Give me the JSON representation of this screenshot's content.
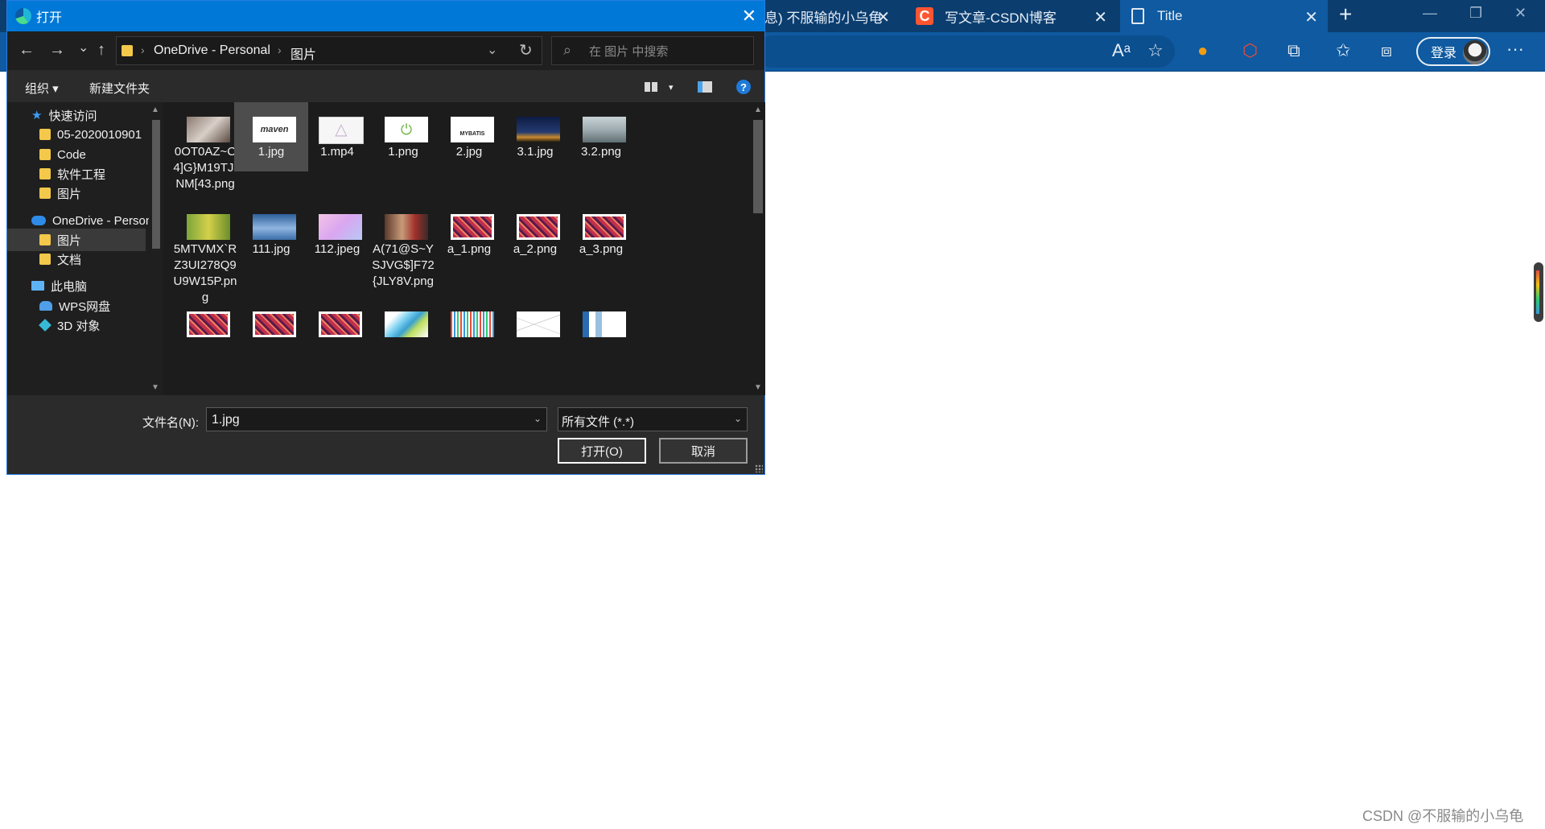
{
  "browser": {
    "tabs": [
      {
        "label": "息) 不服输的小乌龟",
        "close": "✕"
      },
      {
        "label": "写文章-CSDN博客",
        "close": "✕",
        "icon_letter": "C"
      },
      {
        "label": "Title",
        "close": "✕"
      }
    ],
    "new_tab": "+",
    "window_controls": {
      "minimize": "—",
      "restore": "❐",
      "close": "✕"
    },
    "toolbar_icons": [
      "read-aloud-icon",
      "add-favorite-icon",
      "copilot-icon",
      "extension-red-icon",
      "extensions-icon",
      "favorites-icon",
      "collections-icon"
    ],
    "login_label": "登录",
    "more": "···"
  },
  "dialog": {
    "title": "打开",
    "close": "✕",
    "nav": {
      "back": "←",
      "forward": "→",
      "recent": "⌄",
      "up": "↑"
    },
    "breadcrumb": [
      "OneDrive - Personal",
      "图片"
    ],
    "search_placeholder": "在 图片 中搜索",
    "commands": {
      "organize": "组织 ▾",
      "new_folder": "新建文件夹",
      "view_dd": "▾",
      "help": "?"
    },
    "sidebar": [
      {
        "label": "快速访问",
        "icon": "star-icon",
        "indent": 0
      },
      {
        "label": "05-2020010901",
        "icon": "folder-icon",
        "indent": 1
      },
      {
        "label": "Code",
        "icon": "folder-icon",
        "indent": 1
      },
      {
        "label": "软件工程",
        "icon": "folder-icon",
        "indent": 1
      },
      {
        "label": "图片",
        "icon": "folder-icon",
        "indent": 1
      },
      {
        "label": "OneDrive - Personal",
        "icon": "cloud-icon",
        "indent": 0
      },
      {
        "label": "图片",
        "icon": "folder-icon",
        "indent": 1,
        "selected": true
      },
      {
        "label": "文档",
        "icon": "folder-icon",
        "indent": 1
      },
      {
        "label": "此电脑",
        "icon": "pc-icon",
        "indent": 0
      },
      {
        "label": "WPS网盘",
        "icon": "wps-cloud-icon",
        "indent": 1
      },
      {
        "label": "3D 对象",
        "icon": "cube-icon",
        "indent": 1
      }
    ],
    "files": [
      {
        "name": "0OT0AZ~C4]G}M19TJINM[43.png",
        "thumb": "photo-gray"
      },
      {
        "name": "1.jpg",
        "thumb": "maven",
        "selected": true,
        "thumb_text": "maven"
      },
      {
        "name": "1.mp4",
        "thumb": "video"
      },
      {
        "name": "1.png",
        "thumb": "spring"
      },
      {
        "name": "2.jpg",
        "thumb": "mybatis",
        "thumb_text": "MYBATIS"
      },
      {
        "name": "3.1.jpg",
        "thumb": "night"
      },
      {
        "name": "3.2.png",
        "thumb": "city"
      },
      {
        "name": "5MTVMX`RZ3UI278Q9U9W15P.png",
        "thumb": "fruit"
      },
      {
        "name": "111.jpg",
        "thumb": "sea"
      },
      {
        "name": "112.jpeg",
        "thumb": "pink"
      },
      {
        "name": "A(71@S~YSJVG$]F72{JLY8V.png",
        "thumb": "people"
      },
      {
        "name": "a_1.png",
        "thumb": "heatmap"
      },
      {
        "name": "a_2.png",
        "thumb": "heatmap"
      },
      {
        "name": "a_3.png",
        "thumb": "heatmap"
      },
      {
        "name": "",
        "thumb": "heatmap"
      },
      {
        "name": "",
        "thumb": "heatmap"
      },
      {
        "name": "",
        "thumb": "heatmap"
      },
      {
        "name": "",
        "thumb": "surface"
      },
      {
        "name": "",
        "thumb": "bars"
      },
      {
        "name": "",
        "thumb": "lines"
      },
      {
        "name": "",
        "thumb": "diagram"
      }
    ],
    "filename_label": "文件名(N):",
    "filename_value": "1.jpg",
    "filter_value": "所有文件 (*.*)",
    "open_button": "打开(O)",
    "cancel_button": "取消"
  },
  "watermark": "CSDN @不服输的小乌龟"
}
